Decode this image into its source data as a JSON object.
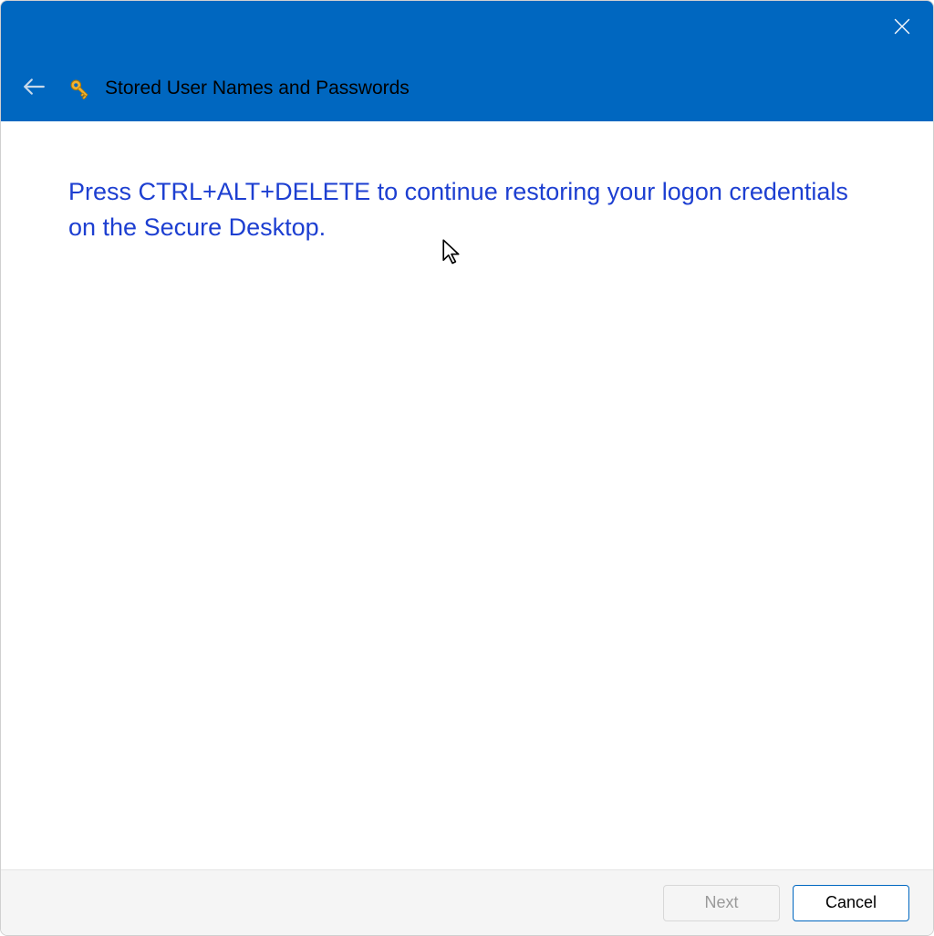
{
  "header": {
    "title": "Stored User Names and Passwords"
  },
  "content": {
    "instruction": "Press CTRL+ALT+DELETE to continue restoring your logon credentials on the Secure Desktop."
  },
  "footer": {
    "next_label": "Next",
    "cancel_label": "Cancel"
  },
  "colors": {
    "accent": "#0067c0",
    "instruction_text": "#1d3fd1"
  }
}
